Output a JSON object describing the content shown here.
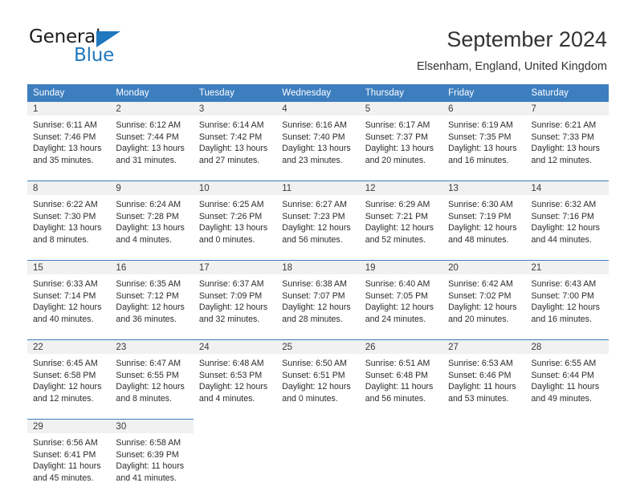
{
  "brand": {
    "name_part1": "General",
    "name_part2": "Blue",
    "triangle_color": "#1f77bd"
  },
  "header": {
    "title": "September 2024",
    "subtitle": "Elsenham, England, United Kingdom"
  },
  "theme": {
    "header_blue": "#3d7ebf",
    "daynum_band": "#f1f1f1",
    "text": "#2b2b2b"
  },
  "calendar": {
    "weekday_headers": [
      "Sunday",
      "Monday",
      "Tuesday",
      "Wednesday",
      "Thursday",
      "Friday",
      "Saturday"
    ],
    "labels": {
      "sunrise": "Sunrise:",
      "sunset": "Sunset:",
      "daylight": "Daylight:"
    },
    "weeks": [
      [
        {
          "day": "1",
          "sunrise": "Sunrise: 6:11 AM",
          "sunset": "Sunset: 7:46 PM",
          "daylight_line1": "Daylight: 13 hours",
          "daylight_line2": "and 35 minutes."
        },
        {
          "day": "2",
          "sunrise": "Sunrise: 6:12 AM",
          "sunset": "Sunset: 7:44 PM",
          "daylight_line1": "Daylight: 13 hours",
          "daylight_line2": "and 31 minutes."
        },
        {
          "day": "3",
          "sunrise": "Sunrise: 6:14 AM",
          "sunset": "Sunset: 7:42 PM",
          "daylight_line1": "Daylight: 13 hours",
          "daylight_line2": "and 27 minutes."
        },
        {
          "day": "4",
          "sunrise": "Sunrise: 6:16 AM",
          "sunset": "Sunset: 7:40 PM",
          "daylight_line1": "Daylight: 13 hours",
          "daylight_line2": "and 23 minutes."
        },
        {
          "day": "5",
          "sunrise": "Sunrise: 6:17 AM",
          "sunset": "Sunset: 7:37 PM",
          "daylight_line1": "Daylight: 13 hours",
          "daylight_line2": "and 20 minutes."
        },
        {
          "day": "6",
          "sunrise": "Sunrise: 6:19 AM",
          "sunset": "Sunset: 7:35 PM",
          "daylight_line1": "Daylight: 13 hours",
          "daylight_line2": "and 16 minutes."
        },
        {
          "day": "7",
          "sunrise": "Sunrise: 6:21 AM",
          "sunset": "Sunset: 7:33 PM",
          "daylight_line1": "Daylight: 13 hours",
          "daylight_line2": "and 12 minutes."
        }
      ],
      [
        {
          "day": "8",
          "sunrise": "Sunrise: 6:22 AM",
          "sunset": "Sunset: 7:30 PM",
          "daylight_line1": "Daylight: 13 hours",
          "daylight_line2": "and 8 minutes."
        },
        {
          "day": "9",
          "sunrise": "Sunrise: 6:24 AM",
          "sunset": "Sunset: 7:28 PM",
          "daylight_line1": "Daylight: 13 hours",
          "daylight_line2": "and 4 minutes."
        },
        {
          "day": "10",
          "sunrise": "Sunrise: 6:25 AM",
          "sunset": "Sunset: 7:26 PM",
          "daylight_line1": "Daylight: 13 hours",
          "daylight_line2": "and 0 minutes."
        },
        {
          "day": "11",
          "sunrise": "Sunrise: 6:27 AM",
          "sunset": "Sunset: 7:23 PM",
          "daylight_line1": "Daylight: 12 hours",
          "daylight_line2": "and 56 minutes."
        },
        {
          "day": "12",
          "sunrise": "Sunrise: 6:29 AM",
          "sunset": "Sunset: 7:21 PM",
          "daylight_line1": "Daylight: 12 hours",
          "daylight_line2": "and 52 minutes."
        },
        {
          "day": "13",
          "sunrise": "Sunrise: 6:30 AM",
          "sunset": "Sunset: 7:19 PM",
          "daylight_line1": "Daylight: 12 hours",
          "daylight_line2": "and 48 minutes."
        },
        {
          "day": "14",
          "sunrise": "Sunrise: 6:32 AM",
          "sunset": "Sunset: 7:16 PM",
          "daylight_line1": "Daylight: 12 hours",
          "daylight_line2": "and 44 minutes."
        }
      ],
      [
        {
          "day": "15",
          "sunrise": "Sunrise: 6:33 AM",
          "sunset": "Sunset: 7:14 PM",
          "daylight_line1": "Daylight: 12 hours",
          "daylight_line2": "and 40 minutes."
        },
        {
          "day": "16",
          "sunrise": "Sunrise: 6:35 AM",
          "sunset": "Sunset: 7:12 PM",
          "daylight_line1": "Daylight: 12 hours",
          "daylight_line2": "and 36 minutes."
        },
        {
          "day": "17",
          "sunrise": "Sunrise: 6:37 AM",
          "sunset": "Sunset: 7:09 PM",
          "daylight_line1": "Daylight: 12 hours",
          "daylight_line2": "and 32 minutes."
        },
        {
          "day": "18",
          "sunrise": "Sunrise: 6:38 AM",
          "sunset": "Sunset: 7:07 PM",
          "daylight_line1": "Daylight: 12 hours",
          "daylight_line2": "and 28 minutes."
        },
        {
          "day": "19",
          "sunrise": "Sunrise: 6:40 AM",
          "sunset": "Sunset: 7:05 PM",
          "daylight_line1": "Daylight: 12 hours",
          "daylight_line2": "and 24 minutes."
        },
        {
          "day": "20",
          "sunrise": "Sunrise: 6:42 AM",
          "sunset": "Sunset: 7:02 PM",
          "daylight_line1": "Daylight: 12 hours",
          "daylight_line2": "and 20 minutes."
        },
        {
          "day": "21",
          "sunrise": "Sunrise: 6:43 AM",
          "sunset": "Sunset: 7:00 PM",
          "daylight_line1": "Daylight: 12 hours",
          "daylight_line2": "and 16 minutes."
        }
      ],
      [
        {
          "day": "22",
          "sunrise": "Sunrise: 6:45 AM",
          "sunset": "Sunset: 6:58 PM",
          "daylight_line1": "Daylight: 12 hours",
          "daylight_line2": "and 12 minutes."
        },
        {
          "day": "23",
          "sunrise": "Sunrise: 6:47 AM",
          "sunset": "Sunset: 6:55 PM",
          "daylight_line1": "Daylight: 12 hours",
          "daylight_line2": "and 8 minutes."
        },
        {
          "day": "24",
          "sunrise": "Sunrise: 6:48 AM",
          "sunset": "Sunset: 6:53 PM",
          "daylight_line1": "Daylight: 12 hours",
          "daylight_line2": "and 4 minutes."
        },
        {
          "day": "25",
          "sunrise": "Sunrise: 6:50 AM",
          "sunset": "Sunset: 6:51 PM",
          "daylight_line1": "Daylight: 12 hours",
          "daylight_line2": "and 0 minutes."
        },
        {
          "day": "26",
          "sunrise": "Sunrise: 6:51 AM",
          "sunset": "Sunset: 6:48 PM",
          "daylight_line1": "Daylight: 11 hours",
          "daylight_line2": "and 56 minutes."
        },
        {
          "day": "27",
          "sunrise": "Sunrise: 6:53 AM",
          "sunset": "Sunset: 6:46 PM",
          "daylight_line1": "Daylight: 11 hours",
          "daylight_line2": "and 53 minutes."
        },
        {
          "day": "28",
          "sunrise": "Sunrise: 6:55 AM",
          "sunset": "Sunset: 6:44 PM",
          "daylight_line1": "Daylight: 11 hours",
          "daylight_line2": "and 49 minutes."
        }
      ],
      [
        {
          "day": "29",
          "sunrise": "Sunrise: 6:56 AM",
          "sunset": "Sunset: 6:41 PM",
          "daylight_line1": "Daylight: 11 hours",
          "daylight_line2": "and 45 minutes."
        },
        {
          "day": "30",
          "sunrise": "Sunrise: 6:58 AM",
          "sunset": "Sunset: 6:39 PM",
          "daylight_line1": "Daylight: 11 hours",
          "daylight_line2": "and 41 minutes."
        },
        null,
        null,
        null,
        null,
        null
      ]
    ]
  }
}
